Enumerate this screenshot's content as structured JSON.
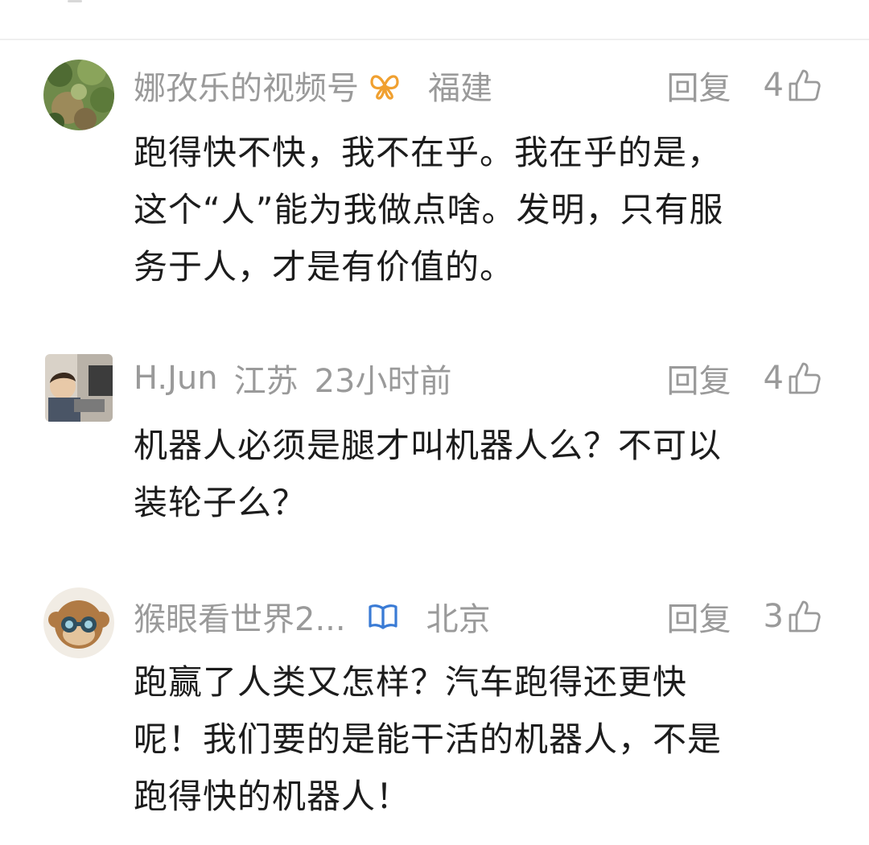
{
  "comments": [
    {
      "username": "娜孜乐的视频号",
      "badge_icon": "butterfly-icon",
      "badge_color": "#f0a030",
      "location": "福建",
      "time": "",
      "reply_label": "回复",
      "likes": "4",
      "text_lines": [
        "跑得快不快，我不在乎。我在乎的是，",
        "这个“人”能为我做点啥。发明，只有服",
        "务于人，才是有价值的。"
      ]
    },
    {
      "username": "H.Jun",
      "badge_icon": "",
      "location": "江苏",
      "time": "23小时前",
      "reply_label": "回复",
      "likes": "4",
      "text_lines": [
        "机器人必须是腿才叫机器人么？不可以",
        "装轮子么？"
      ]
    },
    {
      "username": "猴眼看世界2...",
      "badge_icon": "open-book-icon",
      "badge_color": "#3a7bd5",
      "location": "北京",
      "time": "",
      "reply_label": "回复",
      "likes": "3",
      "text_lines": [
        "跑赢了人类又怎样？汽车跑得还更快",
        "呢！我们要的是能干活的机器人，不是",
        "跑得快的机器人！"
      ]
    }
  ]
}
